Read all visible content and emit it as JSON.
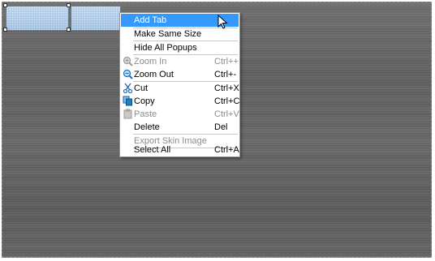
{
  "menu": {
    "items": [
      {
        "label": "Add Tab",
        "shortcut": "",
        "icon": "",
        "state": "highlighted"
      },
      {
        "label": "Make Same Size",
        "shortcut": "",
        "icon": "",
        "state": "enabled"
      },
      {
        "label": "Hide All Popups",
        "shortcut": "",
        "icon": "",
        "state": "enabled"
      },
      {
        "label": "Zoom In",
        "shortcut": "Ctrl++",
        "icon": "zoom-in-icon",
        "state": "disabled"
      },
      {
        "label": "Zoom Out",
        "shortcut": "Ctrl+-",
        "icon": "zoom-out-icon",
        "state": "enabled"
      },
      {
        "label": "Cut",
        "shortcut": "Ctrl+X",
        "icon": "scissors-icon",
        "state": "enabled"
      },
      {
        "label": "Copy",
        "shortcut": "Ctrl+C",
        "icon": "copy-icon",
        "state": "enabled"
      },
      {
        "label": "Paste",
        "shortcut": "Ctrl+V",
        "icon": "paste-icon",
        "state": "disabled"
      },
      {
        "label": "Delete",
        "shortcut": "Del",
        "icon": "",
        "state": "enabled"
      },
      {
        "label": "Export Skin Image",
        "shortcut": "",
        "icon": "",
        "state": "disabled"
      },
      {
        "label": "Select All",
        "shortcut": "Ctrl+A",
        "icon": "",
        "state": "enabled"
      }
    ]
  },
  "colors": {
    "highlight": "#3399ff",
    "disabled_text": "#8c8c8c",
    "tab_fill": "#a9c6e3"
  },
  "cursor_icon": "arrow-cursor-icon"
}
